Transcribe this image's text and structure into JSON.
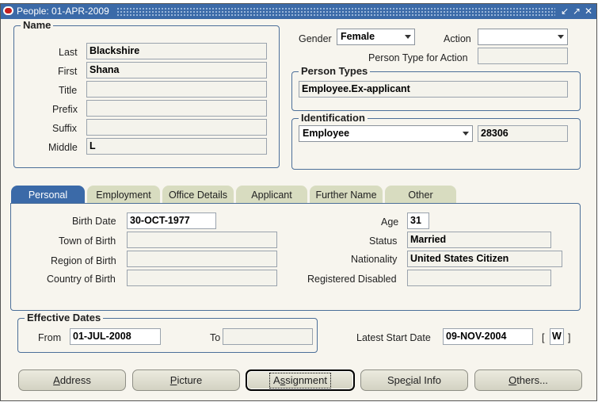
{
  "window": {
    "title": "People: 01-APR-2009"
  },
  "name_section": {
    "legend": "Name",
    "last_label": "Last",
    "last_value": "Blackshire",
    "first_label": "First",
    "first_value": "Shana",
    "title_label": "Title",
    "title_value": "",
    "prefix_label": "Prefix",
    "prefix_value": "",
    "suffix_label": "Suffix",
    "suffix_value": "",
    "middle_label": "Middle",
    "middle_value": "L"
  },
  "gender": {
    "label": "Gender",
    "value": "Female"
  },
  "action": {
    "label": "Action",
    "value": ""
  },
  "person_type_for_action": {
    "label": "Person Type for Action",
    "value": ""
  },
  "person_types": {
    "legend": "Person Types",
    "value": "Employee.Ex-applicant"
  },
  "identification": {
    "legend": "Identification",
    "type_value": "Employee",
    "number_value": "28306"
  },
  "tabs": [
    {
      "label": "Personal"
    },
    {
      "label": "Employment"
    },
    {
      "label": "Office Details"
    },
    {
      "label": "Applicant"
    },
    {
      "label": "Further Name"
    },
    {
      "label": "Other"
    }
  ],
  "personal": {
    "birth_date_label": "Birth Date",
    "birth_date_value": "30-OCT-1977",
    "town_label": "Town of Birth",
    "town_value": "",
    "region_label": "Region of Birth",
    "region_value": "",
    "country_label": "Country of Birth",
    "country_value": "",
    "age_label": "Age",
    "age_value": "31",
    "status_label": "Status",
    "status_value": "Married",
    "nationality_label": "Nationality",
    "nationality_value": "United States Citizen",
    "registered_disabled_label": "Registered Disabled",
    "registered_disabled_value": ""
  },
  "effective_dates": {
    "legend": "Effective Dates",
    "from_label": "From",
    "from_value": "01-JUL-2008",
    "to_label": "To",
    "to_value": ""
  },
  "latest_start": {
    "label": "Latest Start Date",
    "value": "09-NOV-2004",
    "bracket_open": "[",
    "bracket_value": "W",
    "bracket_close": "]"
  },
  "buttons": {
    "address": {
      "first": "A",
      "rest": "ddress"
    },
    "picture": {
      "first": "P",
      "rest": "icture"
    },
    "assignment": {
      "pre": "A",
      "u": "s",
      "rest": "signment"
    },
    "special_info": {
      "pre": "Spe",
      "u": "c",
      "rest": "ial Info"
    },
    "others": {
      "first": "O",
      "rest": "thers..."
    }
  },
  "colors": {
    "titlebar": "#3b6aa8",
    "active_tab": "#3b6aa8",
    "tab": "#d8dcc0",
    "panel_bg": "#f7f5ee"
  }
}
